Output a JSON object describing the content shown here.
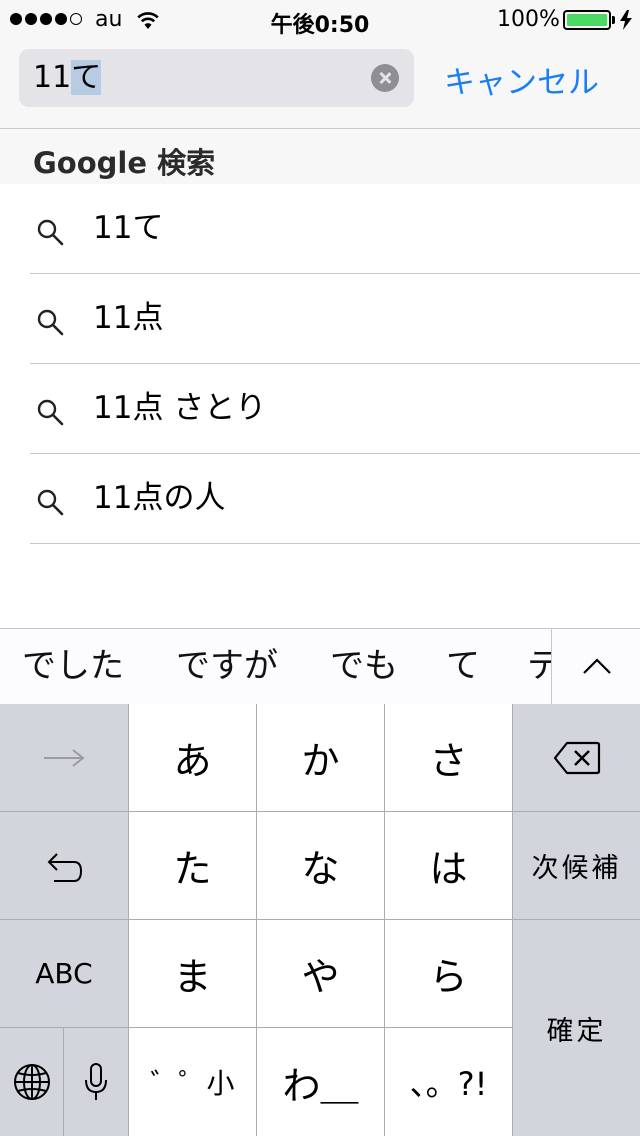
{
  "status_bar": {
    "carrier": "au",
    "time": "午後0:50",
    "battery_percent": "100%",
    "battery_level": 1.0,
    "battery_color": "#4cd964"
  },
  "search": {
    "query_prefix": "11",
    "query_marked": "て",
    "cancel_label": "キャンセル",
    "accent_color": "#1a7ef6"
  },
  "section": {
    "title": "Google 検索"
  },
  "suggestions": [
    "11て",
    "11点",
    "11点 さとり",
    "11点の人"
  ],
  "predictions": [
    "でした",
    "ですが",
    "でも",
    "て",
    "テ"
  ],
  "keyboard": {
    "row1": [
      "あ",
      "か",
      "さ"
    ],
    "row2": [
      "た",
      "な",
      "は"
    ],
    "row3": [
      "ま",
      "や",
      "ら"
    ],
    "row4": [
      "゛゜小",
      "わ＿",
      "、。?!"
    ],
    "next_candidate_label": "次候補",
    "abc_label": "ABC",
    "confirm_label": "確定"
  },
  "icons": {
    "signal": "signal-dots-icon",
    "wifi": "wifi-icon",
    "battery": "battery-icon",
    "charging": "charging-bolt-icon",
    "clear": "clear-text-icon",
    "search": "magnifier-icon",
    "expand": "chevron-up-icon",
    "arrow": "arrow-right-icon",
    "undo": "undo-icon",
    "delete": "delete-backspace-icon",
    "globe": "globe-icon",
    "mic": "microphone-icon"
  }
}
